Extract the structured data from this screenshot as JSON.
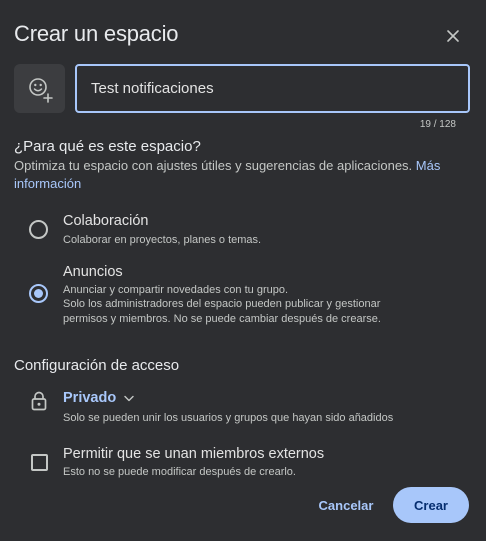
{
  "dialog": {
    "title": "Crear un espacio"
  },
  "name_field": {
    "value": "Test notificaciones",
    "char_count": "19 / 128"
  },
  "purpose": {
    "title": "¿Para qué es este espacio?",
    "description": "Optimiza tu espacio con ajustes útiles y sugerencias de aplicaciones.",
    "more_info_link": "Más información",
    "options": [
      {
        "label": "Colaboración",
        "description": "Colaborar en proyectos, planes o temas.",
        "selected": false
      },
      {
        "label": "Anuncios",
        "description_line1": "Anunciar y compartir novedades con tu grupo.",
        "description_line2": "Solo los administradores del espacio pueden publicar y gestionar",
        "description_line3": "permisos y miembros. No se puede cambiar después de crearse.",
        "selected": true
      }
    ]
  },
  "access": {
    "title": "Configuración de acceso",
    "privacy_value": "Privado",
    "privacy_description": "Solo se pueden unir los usuarios y grupos que hayan sido añadidos",
    "external_members_label": "Permitir que se unan miembros externos",
    "external_members_description": "Esto no se puede modificar después de crearlo.",
    "external_members_checked": false
  },
  "actions": {
    "cancel_label": "Cancelar",
    "create_label": "Crear"
  },
  "colors": {
    "background": "#2d2e31",
    "accent": "#a8c7fa",
    "text": "#e3e3e3",
    "secondary_text": "#c4c7c5"
  },
  "icons": {
    "close": "close-icon",
    "emoji": "add-emoji-icon",
    "lock": "lock-icon",
    "dropdown": "chevron-down-icon"
  }
}
